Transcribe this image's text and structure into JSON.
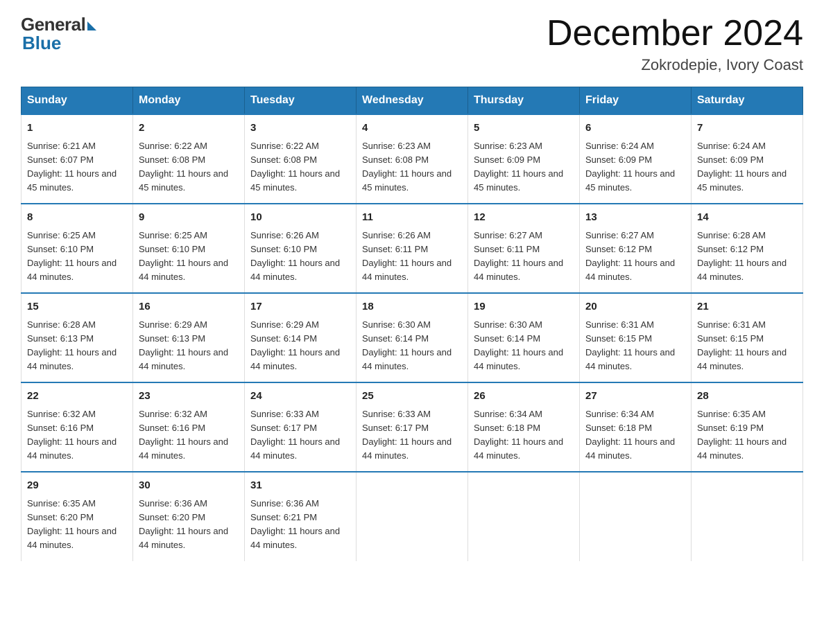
{
  "logo": {
    "general": "General",
    "blue": "Blue"
  },
  "title": "December 2024",
  "location": "Zokrodepie, Ivory Coast",
  "days_of_week": [
    "Sunday",
    "Monday",
    "Tuesday",
    "Wednesday",
    "Thursday",
    "Friday",
    "Saturday"
  ],
  "weeks": [
    [
      {
        "day": "1",
        "sunrise": "6:21 AM",
        "sunset": "6:07 PM",
        "daylight": "11 hours and 45 minutes."
      },
      {
        "day": "2",
        "sunrise": "6:22 AM",
        "sunset": "6:08 PM",
        "daylight": "11 hours and 45 minutes."
      },
      {
        "day": "3",
        "sunrise": "6:22 AM",
        "sunset": "6:08 PM",
        "daylight": "11 hours and 45 minutes."
      },
      {
        "day": "4",
        "sunrise": "6:23 AM",
        "sunset": "6:08 PM",
        "daylight": "11 hours and 45 minutes."
      },
      {
        "day": "5",
        "sunrise": "6:23 AM",
        "sunset": "6:09 PM",
        "daylight": "11 hours and 45 minutes."
      },
      {
        "day": "6",
        "sunrise": "6:24 AM",
        "sunset": "6:09 PM",
        "daylight": "11 hours and 45 minutes."
      },
      {
        "day": "7",
        "sunrise": "6:24 AM",
        "sunset": "6:09 PM",
        "daylight": "11 hours and 45 minutes."
      }
    ],
    [
      {
        "day": "8",
        "sunrise": "6:25 AM",
        "sunset": "6:10 PM",
        "daylight": "11 hours and 44 minutes."
      },
      {
        "day": "9",
        "sunrise": "6:25 AM",
        "sunset": "6:10 PM",
        "daylight": "11 hours and 44 minutes."
      },
      {
        "day": "10",
        "sunrise": "6:26 AM",
        "sunset": "6:10 PM",
        "daylight": "11 hours and 44 minutes."
      },
      {
        "day": "11",
        "sunrise": "6:26 AM",
        "sunset": "6:11 PM",
        "daylight": "11 hours and 44 minutes."
      },
      {
        "day": "12",
        "sunrise": "6:27 AM",
        "sunset": "6:11 PM",
        "daylight": "11 hours and 44 minutes."
      },
      {
        "day": "13",
        "sunrise": "6:27 AM",
        "sunset": "6:12 PM",
        "daylight": "11 hours and 44 minutes."
      },
      {
        "day": "14",
        "sunrise": "6:28 AM",
        "sunset": "6:12 PM",
        "daylight": "11 hours and 44 minutes."
      }
    ],
    [
      {
        "day": "15",
        "sunrise": "6:28 AM",
        "sunset": "6:13 PM",
        "daylight": "11 hours and 44 minutes."
      },
      {
        "day": "16",
        "sunrise": "6:29 AM",
        "sunset": "6:13 PM",
        "daylight": "11 hours and 44 minutes."
      },
      {
        "day": "17",
        "sunrise": "6:29 AM",
        "sunset": "6:14 PM",
        "daylight": "11 hours and 44 minutes."
      },
      {
        "day": "18",
        "sunrise": "6:30 AM",
        "sunset": "6:14 PM",
        "daylight": "11 hours and 44 minutes."
      },
      {
        "day": "19",
        "sunrise": "6:30 AM",
        "sunset": "6:14 PM",
        "daylight": "11 hours and 44 minutes."
      },
      {
        "day": "20",
        "sunrise": "6:31 AM",
        "sunset": "6:15 PM",
        "daylight": "11 hours and 44 minutes."
      },
      {
        "day": "21",
        "sunrise": "6:31 AM",
        "sunset": "6:15 PM",
        "daylight": "11 hours and 44 minutes."
      }
    ],
    [
      {
        "day": "22",
        "sunrise": "6:32 AM",
        "sunset": "6:16 PM",
        "daylight": "11 hours and 44 minutes."
      },
      {
        "day": "23",
        "sunrise": "6:32 AM",
        "sunset": "6:16 PM",
        "daylight": "11 hours and 44 minutes."
      },
      {
        "day": "24",
        "sunrise": "6:33 AM",
        "sunset": "6:17 PM",
        "daylight": "11 hours and 44 minutes."
      },
      {
        "day": "25",
        "sunrise": "6:33 AM",
        "sunset": "6:17 PM",
        "daylight": "11 hours and 44 minutes."
      },
      {
        "day": "26",
        "sunrise": "6:34 AM",
        "sunset": "6:18 PM",
        "daylight": "11 hours and 44 minutes."
      },
      {
        "day": "27",
        "sunrise": "6:34 AM",
        "sunset": "6:18 PM",
        "daylight": "11 hours and 44 minutes."
      },
      {
        "day": "28",
        "sunrise": "6:35 AM",
        "sunset": "6:19 PM",
        "daylight": "11 hours and 44 minutes."
      }
    ],
    [
      {
        "day": "29",
        "sunrise": "6:35 AM",
        "sunset": "6:20 PM",
        "daylight": "11 hours and 44 minutes."
      },
      {
        "day": "30",
        "sunrise": "6:36 AM",
        "sunset": "6:20 PM",
        "daylight": "11 hours and 44 minutes."
      },
      {
        "day": "31",
        "sunrise": "6:36 AM",
        "sunset": "6:21 PM",
        "daylight": "11 hours and 44 minutes."
      },
      null,
      null,
      null,
      null
    ]
  ],
  "labels": {
    "sunrise": "Sunrise:",
    "sunset": "Sunset:",
    "daylight": "Daylight:"
  }
}
